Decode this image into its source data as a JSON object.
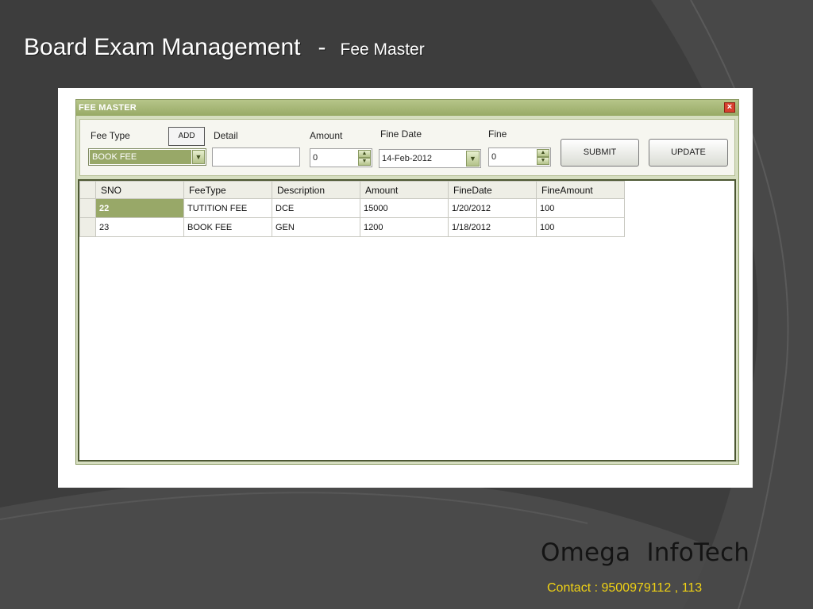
{
  "slide": {
    "title": "Board Exam Management",
    "separator": "-",
    "subtitle": "Fee Master"
  },
  "window": {
    "title": "FEE MASTER",
    "close_icon": "close-icon"
  },
  "form": {
    "fee_type_label": "Fee Type",
    "add_label": "ADD",
    "fee_type_value": "BOOK FEE",
    "detail_label": "Detail",
    "detail_value": "",
    "amount_label": "Amount",
    "amount_value": "0",
    "fine_date_label": "Fine Date",
    "fine_date_value": "14-Feb-2012",
    "fine_label": "Fine",
    "fine_value": "0",
    "submit_label": "SUBMIT",
    "update_label": "UPDATE"
  },
  "grid": {
    "columns": [
      "SNO",
      "FeeType",
      "Description",
      "Amount",
      "FineDate",
      "FineAmount"
    ],
    "rows": [
      [
        "22",
        "TUTITION FEE",
        "DCE",
        "15000",
        "1/20/2012",
        "100"
      ],
      [
        "23",
        "BOOK FEE",
        "GEN",
        "1200",
        "1/18/2012",
        "100"
      ]
    ]
  },
  "footer": {
    "company_name": "Omega  InfoTech",
    "contact": "Contact : 9500979112 , 113"
  },
  "colors": {
    "background": "#3d3d3d",
    "window_green": "#98a868",
    "contact_yellow": "#f0d214"
  }
}
